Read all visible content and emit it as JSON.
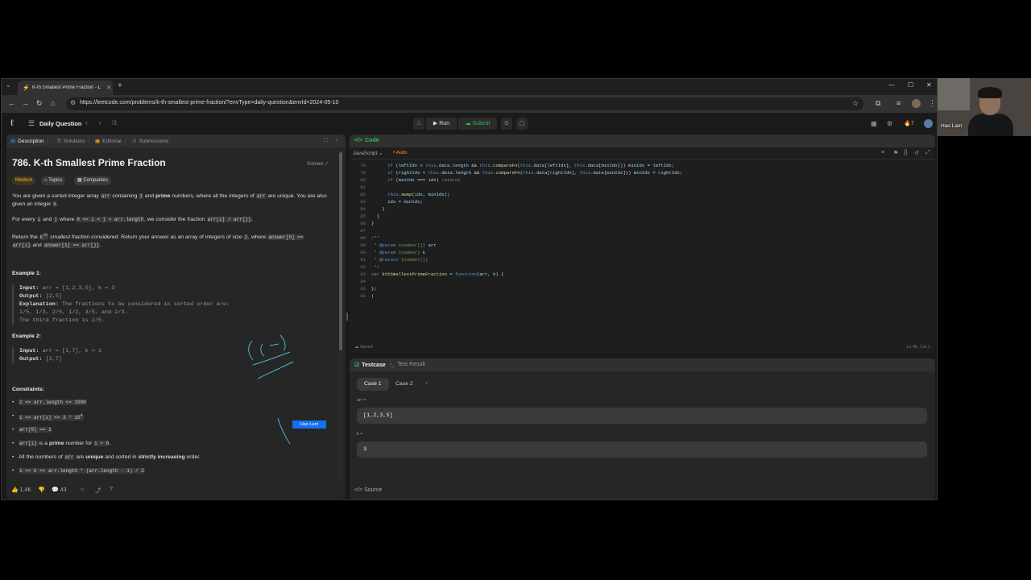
{
  "browser": {
    "tab_title": "K-th Smallest Prime Fraction - L",
    "url": "https://leetcode.com/problems/k-th-smallest-prime-fraction/?envType=daily-question&envId=2024-05-10"
  },
  "header": {
    "daily_label": "Daily Question",
    "run_label": "Run",
    "submit_label": "Submit",
    "streak": "7"
  },
  "left_tabs": {
    "description": "Description",
    "solutions": "Solutions",
    "editorial": "Editorial",
    "submissions": "Submissions"
  },
  "problem": {
    "title": "786. K-th Smallest Prime Fraction",
    "solved": "Solved",
    "difficulty": "Medium",
    "topics": "Topics",
    "companies": "Companies",
    "example1_heading": "Example 1:",
    "example2_heading": "Example 2:",
    "constraints_heading": "Constraints:"
  },
  "stats": {
    "likes": "1.4K",
    "comments": "43"
  },
  "code_panel": {
    "title": "Code",
    "language": "JavaScript",
    "auto": "Auto",
    "saved": "Saved",
    "cursor": "Ln 96, Col 1"
  },
  "test_panel": {
    "testcase_tab": "Testcase",
    "result_tab": "Test Result",
    "case1": "Case 1",
    "case2": "Case 2",
    "arr_label": "arr =",
    "arr_value": "[1,2,3,5]",
    "k_label": "k =",
    "k_value": "3",
    "source": "Source"
  },
  "annotation_label": "Hao Lam",
  "webcam_name": "Hao Lam"
}
